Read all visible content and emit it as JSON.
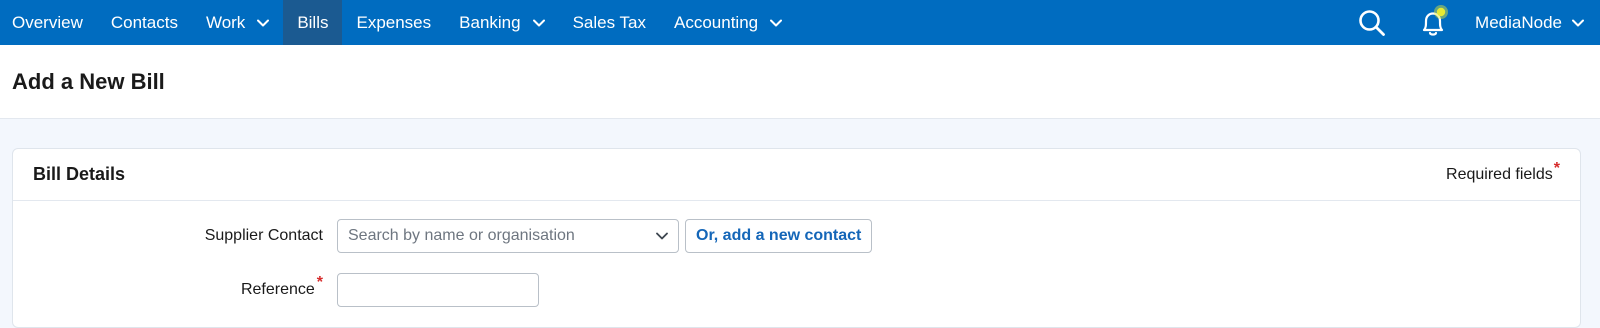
{
  "nav": {
    "items": [
      {
        "label": "Overview",
        "has_dropdown": false,
        "active": false
      },
      {
        "label": "Contacts",
        "has_dropdown": false,
        "active": false
      },
      {
        "label": "Work",
        "has_dropdown": true,
        "active": false
      },
      {
        "label": "Bills",
        "has_dropdown": false,
        "active": true
      },
      {
        "label": "Expenses",
        "has_dropdown": false,
        "active": false
      },
      {
        "label": "Banking",
        "has_dropdown": true,
        "active": false
      },
      {
        "label": "Sales Tax",
        "has_dropdown": false,
        "active": false
      },
      {
        "label": "Accounting",
        "has_dropdown": true,
        "active": false
      }
    ],
    "account_name": "MediaNode",
    "colors": {
      "bar": "#006cc0",
      "active": "#1b5a91",
      "notification_dot": "#e6ea33"
    }
  },
  "page": {
    "title": "Add a New Bill"
  },
  "bill_details": {
    "title": "Bill Details",
    "required_note": "Required fields",
    "required_marker": "*",
    "supplier": {
      "label": "Supplier Contact",
      "placeholder": "Search by name or organisation",
      "add_button": "Or, add a new contact"
    },
    "reference": {
      "label": "Reference",
      "value": ""
    }
  }
}
